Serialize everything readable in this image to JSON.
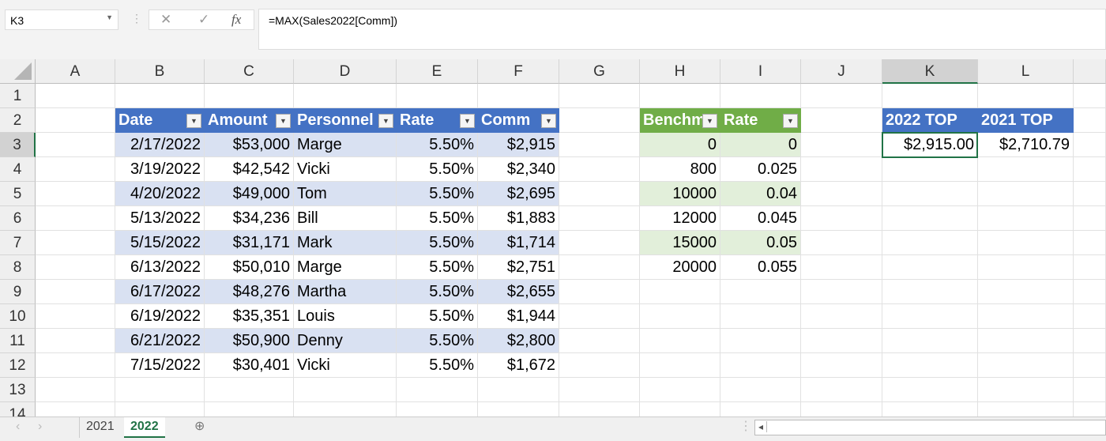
{
  "name_box": "K3",
  "formula": "=MAX(Sales2022[Comm])",
  "formula_buttons": {
    "cancel": "✕",
    "enter": "✓",
    "fx": "fx"
  },
  "columns": [
    "A",
    "B",
    "C",
    "D",
    "E",
    "F",
    "G",
    "H",
    "I",
    "J",
    "K",
    "L"
  ],
  "rows": [
    "1",
    "2",
    "3",
    "4",
    "5",
    "6",
    "7",
    "8",
    "9",
    "10",
    "11",
    "12",
    "13",
    "14"
  ],
  "selected_cell": "K3",
  "sales_table": {
    "headers": [
      "Date",
      "Amount",
      "Personnel",
      "Rate",
      "Comm"
    ],
    "rows": [
      [
        "2/17/2022",
        "$53,000",
        "Marge",
        "5.50%",
        "$2,915"
      ],
      [
        "3/19/2022",
        "$42,542",
        "Vicki",
        "5.50%",
        "$2,340"
      ],
      [
        "4/20/2022",
        "$49,000",
        "Tom",
        "5.50%",
        "$2,695"
      ],
      [
        "5/13/2022",
        "$34,236",
        "Bill",
        "5.50%",
        "$1,883"
      ],
      [
        "5/15/2022",
        "$31,171",
        "Mark",
        "5.50%",
        "$1,714"
      ],
      [
        "6/13/2022",
        "$50,010",
        "Marge",
        "5.50%",
        "$2,751"
      ],
      [
        "6/17/2022",
        "$48,276",
        "Martha",
        "5.50%",
        "$2,655"
      ],
      [
        "6/19/2022",
        "$35,351",
        "Louis",
        "5.50%",
        "$1,944"
      ],
      [
        "6/21/2022",
        "$50,900",
        "Denny",
        "5.50%",
        "$2,800"
      ],
      [
        "7/15/2022",
        "$30,401",
        "Vicki",
        "5.50%",
        "$1,672"
      ]
    ],
    "color": "#4472C4",
    "band": "#D9E1F2"
  },
  "bench_table": {
    "headers": [
      "Benchm",
      "Rate"
    ],
    "rows": [
      [
        "0",
        "0"
      ],
      [
        "800",
        "0.025"
      ],
      [
        "10000",
        "0.04"
      ],
      [
        "12000",
        "0.045"
      ],
      [
        "15000",
        "0.05"
      ],
      [
        "20000",
        "0.055"
      ]
    ],
    "color": "#70AD47",
    "band": "#E2EFDA"
  },
  "top_table": {
    "headers": [
      "2022 TOP",
      "2021 TOP"
    ],
    "values": [
      "$2,915.00",
      "$2,710.79"
    ]
  },
  "sheet_tabs": [
    {
      "label": "2021",
      "active": false
    },
    {
      "label": "2022",
      "active": true
    }
  ],
  "add_sheet_icon": "plus-circle-icon"
}
